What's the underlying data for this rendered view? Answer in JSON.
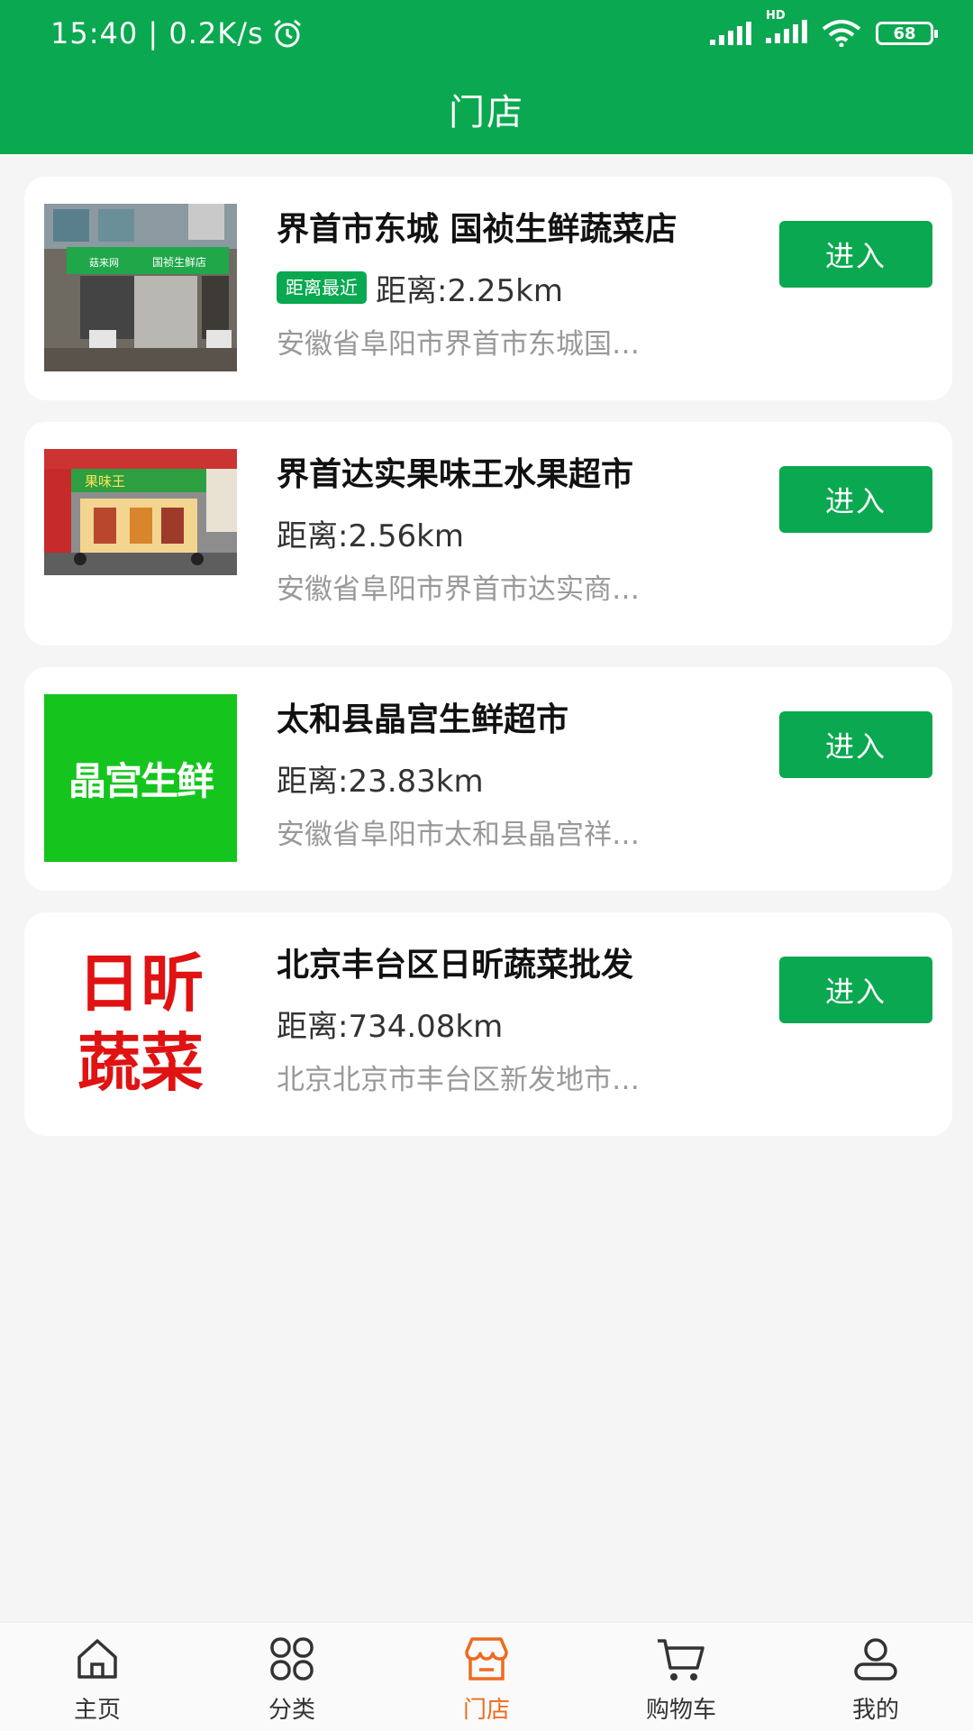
{
  "status_bar": {
    "time_speed": "15:40 | 0.2K/s",
    "network_label": "HD",
    "battery": "68"
  },
  "header": {
    "title": "门店"
  },
  "stores": [
    {
      "name": "界首市东城 国祯生鲜蔬菜店",
      "badge": "距离最近",
      "distance": "距离:2.25km",
      "address": "安徽省阜阳市界首市东城国…",
      "enter_label": "进入",
      "image_text_1": "菇来网",
      "image_text_2": "国祯生鲜店"
    },
    {
      "name": "界首达实果味王水果超市",
      "distance": "距离:2.56km",
      "address": "安徽省阜阳市界首市达实商…",
      "enter_label": "进入",
      "image_text_1": "果味王"
    },
    {
      "name": "太和县晶宫生鲜超市",
      "distance": "距离:23.83km",
      "address": "安徽省阜阳市太和县晶宫祥…",
      "enter_label": "进入",
      "image_text_1": "晶宫生鲜"
    },
    {
      "name": "北京丰台区日昕蔬菜批发",
      "distance": "距离:734.08km",
      "address": "北京北京市丰台区新发地市…",
      "enter_label": "进入",
      "image_text_1": "日昕",
      "image_text_2": "蔬菜"
    }
  ],
  "tabbar": {
    "items": [
      {
        "label": "主页",
        "icon": "home-icon"
      },
      {
        "label": "分类",
        "icon": "category-icon"
      },
      {
        "label": "门店",
        "icon": "store-icon"
      },
      {
        "label": "购物车",
        "icon": "cart-icon"
      },
      {
        "label": "我的",
        "icon": "profile-icon"
      }
    ],
    "active_color": "#ee6a1f"
  },
  "colors": {
    "brand_green": "#0aa850"
  }
}
